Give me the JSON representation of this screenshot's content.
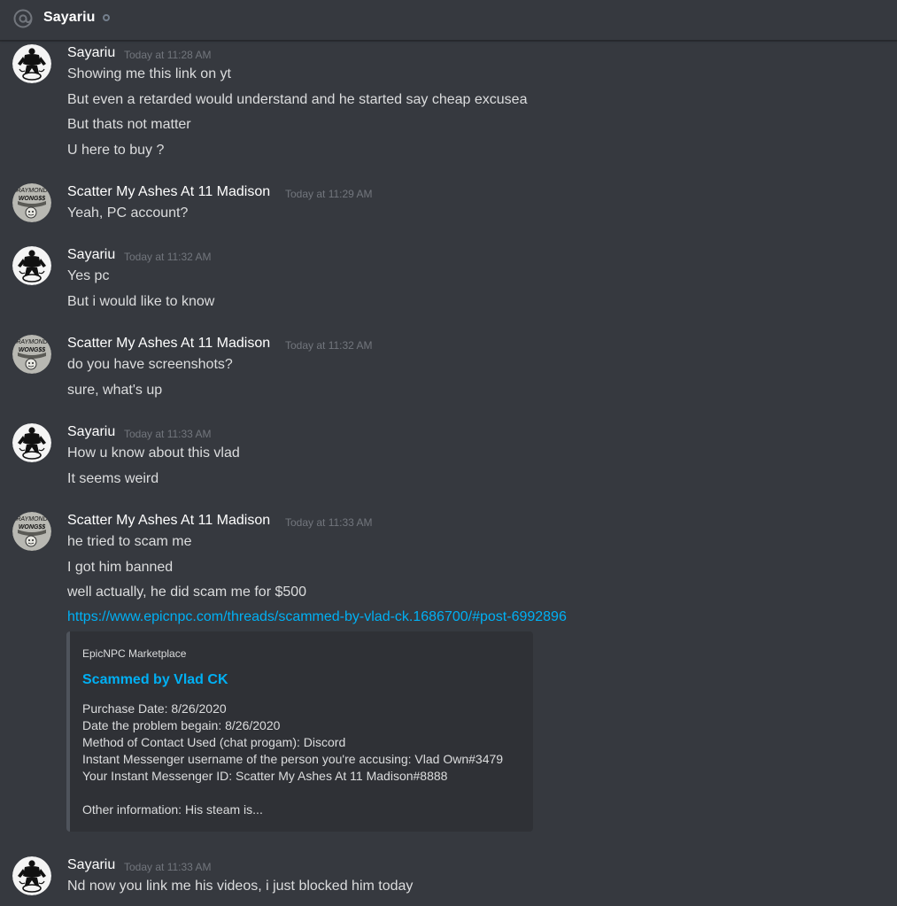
{
  "header": {
    "title": "Sayariu",
    "icon": "at-icon",
    "status": "offline-status-icon"
  },
  "users": {
    "sayariu": "Sayariu",
    "scatter": "Scatter My Ashes At 11 Madison",
    "scatter_avatar_text_1": "RAYMOND",
    "scatter_avatar_text_2": "WONG$$"
  },
  "messages": [
    {
      "author": "Sayariu",
      "time": "Today at 11:28 AM",
      "lines": [
        "Showing me this link on yt",
        "But even a retarded would understand and he started say cheap excusea",
        "But thats not matter",
        "U here to buy ?"
      ]
    },
    {
      "author": "Scatter My Ashes At 11 Madison",
      "time": "Today at 11:29 AM",
      "lines": [
        "Yeah, PC account?"
      ]
    },
    {
      "author": "Sayariu",
      "time": "Today at 11:32 AM",
      "lines": [
        "Yes pc",
        "But i would like to know"
      ]
    },
    {
      "author": "Scatter My Ashes At 11 Madison",
      "time": "Today at 11:32 AM",
      "lines": [
        "do you have screenshots?",
        "sure, what's up"
      ]
    },
    {
      "author": "Sayariu",
      "time": "Today at 11:33 AM",
      "lines": [
        "How u know about this vlad",
        "It seems weird"
      ]
    },
    {
      "author": "Scatter My Ashes At 11 Madison",
      "time": "Today at 11:33 AM",
      "lines": [
        "he tried to scam me",
        "I got him banned",
        "well actually, he did scam me for $500"
      ],
      "link": "https://www.epicnpc.com/threads/scammed-by-vlad-ck.1686700/#post-6992896"
    },
    {
      "author": "Sayariu",
      "time": "Today at 11:33 AM",
      "lines": [
        "Nd now you link me his videos, i just blocked him today"
      ]
    }
  ],
  "embed": {
    "provider": "EpicNPC Marketplace",
    "title": "Scammed by Vlad CK",
    "description": [
      "Purchase Date: 8/26/2020",
      "Date the problem begain: 8/26/2020",
      "Method of Contact Used (chat progam): Discord",
      "Instant Messenger username of the person you're accusing: Vlad Own#3479",
      "Your Instant Messenger ID: Scatter My Ashes At 11 Madison#8888",
      "",
      "Other information: His steam is..."
    ]
  },
  "colors": {
    "background": "#36393f",
    "embed_background": "#2f3136",
    "link": "#00b0f4",
    "timestamp": "#72767d",
    "text": "#dcddde"
  }
}
